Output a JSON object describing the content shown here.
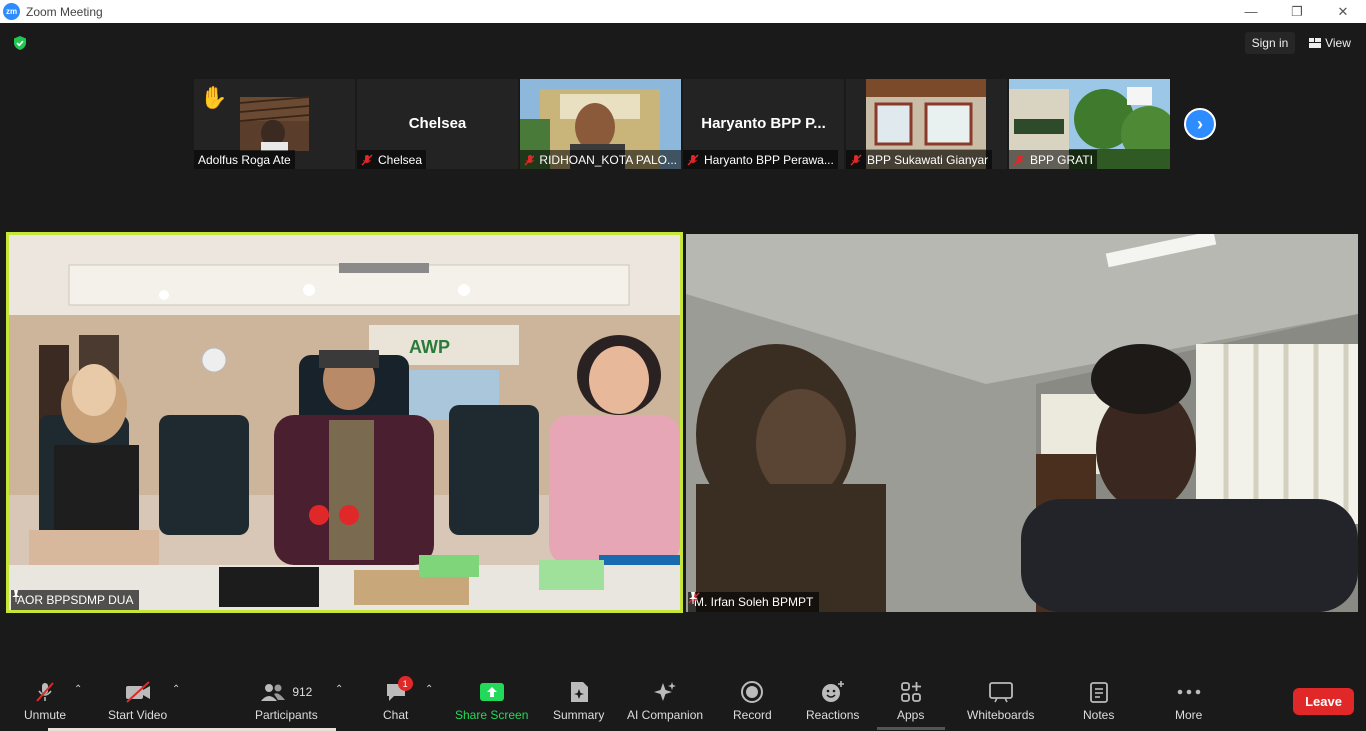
{
  "window": {
    "title": "Zoom Meeting",
    "logo_text": "zm",
    "minimize": "—",
    "restore": "❐",
    "close": "✕"
  },
  "topbar": {
    "sign_in": "Sign in",
    "view": "View"
  },
  "thumbnails": [
    {
      "name": "Adolfus Roga Ate",
      "has_hand": true,
      "muted": false
    },
    {
      "name": "Chelsea",
      "center_name": "Chelsea",
      "muted": true
    },
    {
      "name": "RIDHOAN_KOTA PALO...",
      "muted": true
    },
    {
      "name": "Haryanto BPP Perawa...",
      "center_name": "Haryanto BPP P...",
      "muted": true
    },
    {
      "name": "BPP Sukawati Gianyar",
      "muted": true
    },
    {
      "name": "BPP GRATI",
      "muted": true
    }
  ],
  "videos": {
    "left": {
      "name": "AOR BPPSDMP DUA",
      "highlight_color": "#c6e63a"
    },
    "right": {
      "name": "M. Irfan Soleh BPMPT"
    }
  },
  "toolbar": {
    "unmute": "Unmute",
    "start_video": "Start Video",
    "participants": "Participants",
    "participants_count": "912",
    "chat": "Chat",
    "chat_badge": "1",
    "share_screen": "Share Screen",
    "summary": "Summary",
    "ai_companion": "AI Companion",
    "record": "Record",
    "reactions": "Reactions",
    "apps": "Apps",
    "whiteboards": "Whiteboards",
    "notes": "Notes",
    "more": "More",
    "leave": "Leave"
  },
  "colors": {
    "accent": "#2d8cff",
    "share_green": "#23d959",
    "leave_red": "#e02828",
    "mute_red": "#e02828"
  }
}
